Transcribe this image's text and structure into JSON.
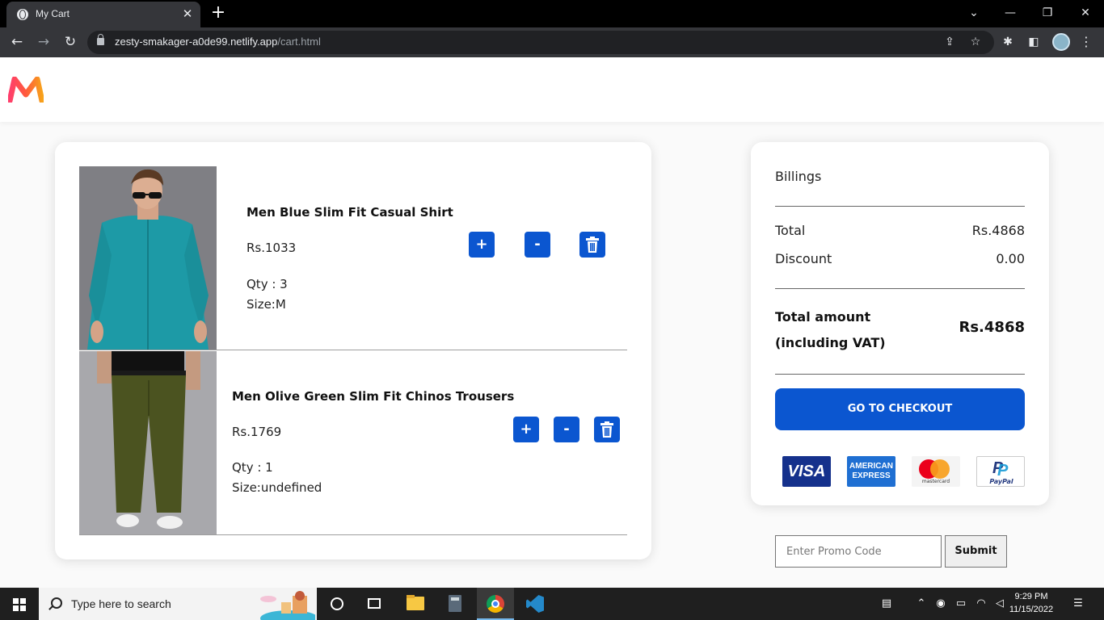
{
  "browser": {
    "tab_title": "My Cart",
    "url_domain": "zesty-smakager-a0de99.netlify.app",
    "url_path": "/cart.html"
  },
  "cart": {
    "items": [
      {
        "name": "Men Blue Slim Fit Casual Shirt",
        "price": "Rs.1033",
        "qty": "Qty : 3",
        "size": "Size:M",
        "plus": "+",
        "minus": "-"
      },
      {
        "name": "Men Olive Green Slim Fit Chinos Trousers",
        "price": "Rs.1769",
        "qty": "Qty : 1",
        "size": "Size:undefined",
        "plus": "+",
        "minus": "-"
      }
    ]
  },
  "billing": {
    "title": "Billings",
    "total_label": "Total",
    "total_value": "Rs.4868",
    "discount_label": "Discount",
    "discount_value": "0.00",
    "total_amount_label": "Total amount (including VAT)",
    "total_amount_value": "Rs.4868",
    "checkout_label": "GO TO CHECKOUT",
    "payment_logos": [
      "visa",
      "american-express",
      "mastercard",
      "paypal"
    ]
  },
  "payment": {
    "visa": "VISA",
    "amex": "AMERICAN EXPRESS",
    "mastercard": "mastercard",
    "paypal": "PayPal"
  },
  "promo": {
    "placeholder": "Enter Promo Code",
    "submit_label": "Submit"
  },
  "taskbar": {
    "search_placeholder": "Type here to search",
    "time": "9:29 PM",
    "date": "11/15/2022"
  },
  "colors": {
    "accent": "#0b56d0",
    "brand_gradient": [
      "#ff3f6c",
      "#f7a21b"
    ]
  }
}
